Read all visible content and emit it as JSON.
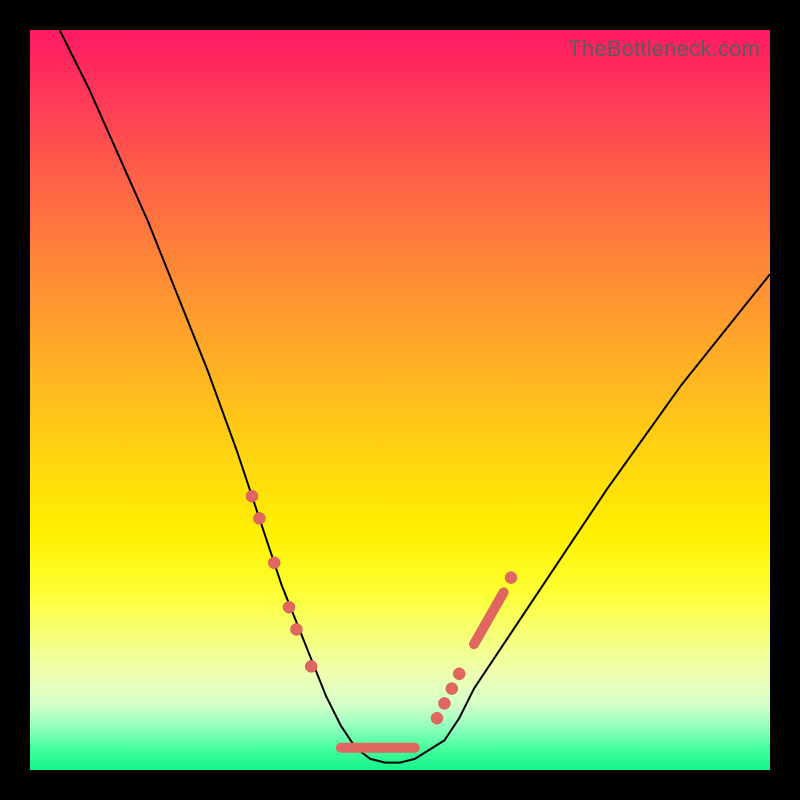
{
  "watermark": "TheBottleneck.com",
  "colors": {
    "frame": "#000000",
    "curve": "#000000",
    "marker": "#e0675f",
    "grad_stops": [
      "#ff1a62",
      "#ff7b3c",
      "#ffd60f",
      "#fff000",
      "#eeffb0",
      "#14f58a"
    ]
  },
  "chart_data": {
    "type": "line",
    "title": "",
    "xlabel": "",
    "ylabel": "",
    "xlim": [
      0,
      100
    ],
    "ylim": [
      0,
      100
    ],
    "note": "Axes unlabeled; values are percent of plot area. y=0 at bottom.",
    "series": [
      {
        "name": "bottleneck-curve",
        "x": [
          4,
          8,
          12,
          16,
          20,
          24,
          28,
          30,
          32,
          34,
          36,
          38,
          40,
          42,
          44,
          46,
          48,
          50,
          52,
          56,
          58,
          60,
          64,
          70,
          78,
          88,
          100
        ],
        "y": [
          100,
          92,
          83,
          74,
          64,
          54,
          43,
          37,
          31,
          25,
          20,
          15,
          10,
          6,
          3,
          1.5,
          1,
          1,
          1.5,
          4,
          7,
          11,
          17,
          26,
          38,
          52,
          67
        ]
      }
    ],
    "marker_groups": [
      {
        "name": "left-descent-dots",
        "points": [
          {
            "x": 30,
            "y": 37
          },
          {
            "x": 31,
            "y": 34
          },
          {
            "x": 33,
            "y": 28
          },
          {
            "x": 35,
            "y": 22
          },
          {
            "x": 36,
            "y": 19
          },
          {
            "x": 38,
            "y": 14
          }
        ]
      },
      {
        "name": "valley-floor",
        "segment": {
          "x1": 42,
          "y1": 3,
          "x2": 52,
          "y2": 3
        }
      },
      {
        "name": "right-ascent-dots",
        "points": [
          {
            "x": 55,
            "y": 7
          },
          {
            "x": 56,
            "y": 9
          },
          {
            "x": 57,
            "y": 11
          },
          {
            "x": 58,
            "y": 13
          }
        ]
      },
      {
        "name": "right-ascent-segment",
        "segment": {
          "x1": 60,
          "y1": 17,
          "x2": 64,
          "y2": 24
        }
      },
      {
        "name": "right-ascent-top-dot",
        "points": [
          {
            "x": 65,
            "y": 26
          }
        ]
      }
    ]
  }
}
